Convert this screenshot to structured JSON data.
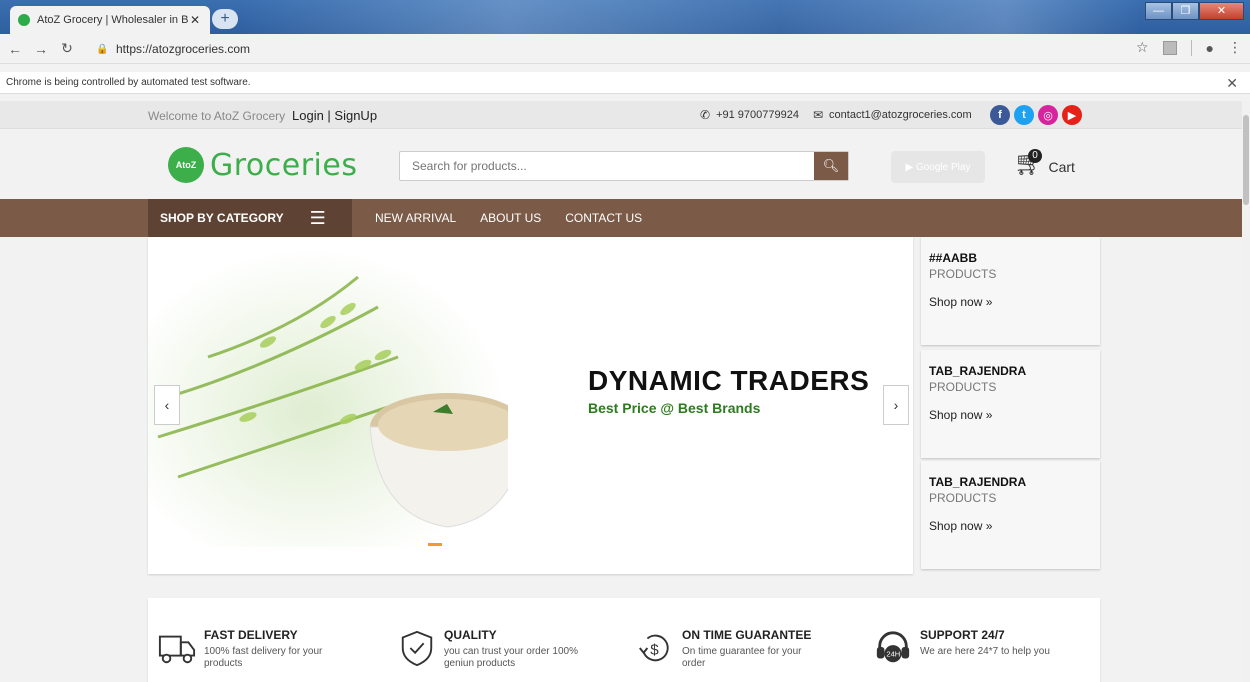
{
  "browser": {
    "tab_title": "AtoZ Grocery | Wholesaler in Ban",
    "url": "https://atozgroceries.com",
    "infobar_text": "Chrome is being controlled by automated test software."
  },
  "topbar": {
    "welcome": "Welcome to AtoZ Grocery",
    "login": "Login | SignUp",
    "phone": "+91 9700779924",
    "email": "contact1@atozgroceries.com"
  },
  "header": {
    "logo_mark": "AtoZ",
    "logo_word": "Groceries",
    "search_placeholder": "Search for products...",
    "google_play": "Google Play",
    "cart_count": "0",
    "cart_label": "Cart"
  },
  "nav": {
    "category": "SHOP BY CATEGORY",
    "links": [
      "NEW ARRIVAL",
      "ABOUT US",
      "CONTACT US"
    ]
  },
  "slider": {
    "headline": "DYNAMIC TRADERS",
    "tagline": "Best Price @ Best Brands"
  },
  "side_cards": [
    {
      "name": "##AABB",
      "sub": "PRODUCTS",
      "shop": "Shop now »"
    },
    {
      "name": "TAB_RAJENDRA",
      "sub": "PRODUCTS",
      "shop": "Shop now »"
    },
    {
      "name": "TAB_RAJENDRA",
      "sub": "PRODUCTS",
      "shop": "Shop now »"
    }
  ],
  "features": [
    {
      "title": "FAST DELIVERY",
      "desc": "100% fast delivery for your products",
      "icon": "truck-icon"
    },
    {
      "title": "QUALITY",
      "desc": "you can trust your order 100% geniun products",
      "icon": "shield-check-icon"
    },
    {
      "title": "ON TIME GUARANTEE",
      "desc": "On time guarantee for your order",
      "icon": "dollar-cycle-icon"
    },
    {
      "title": "SUPPORT 24/7",
      "desc": "We are here 24*7 to help you",
      "icon": "headset-icon"
    }
  ],
  "colors": {
    "brand_brown": "#7b5a48",
    "brand_green": "#3cae4a",
    "accent_orange": "#f39a2c"
  }
}
